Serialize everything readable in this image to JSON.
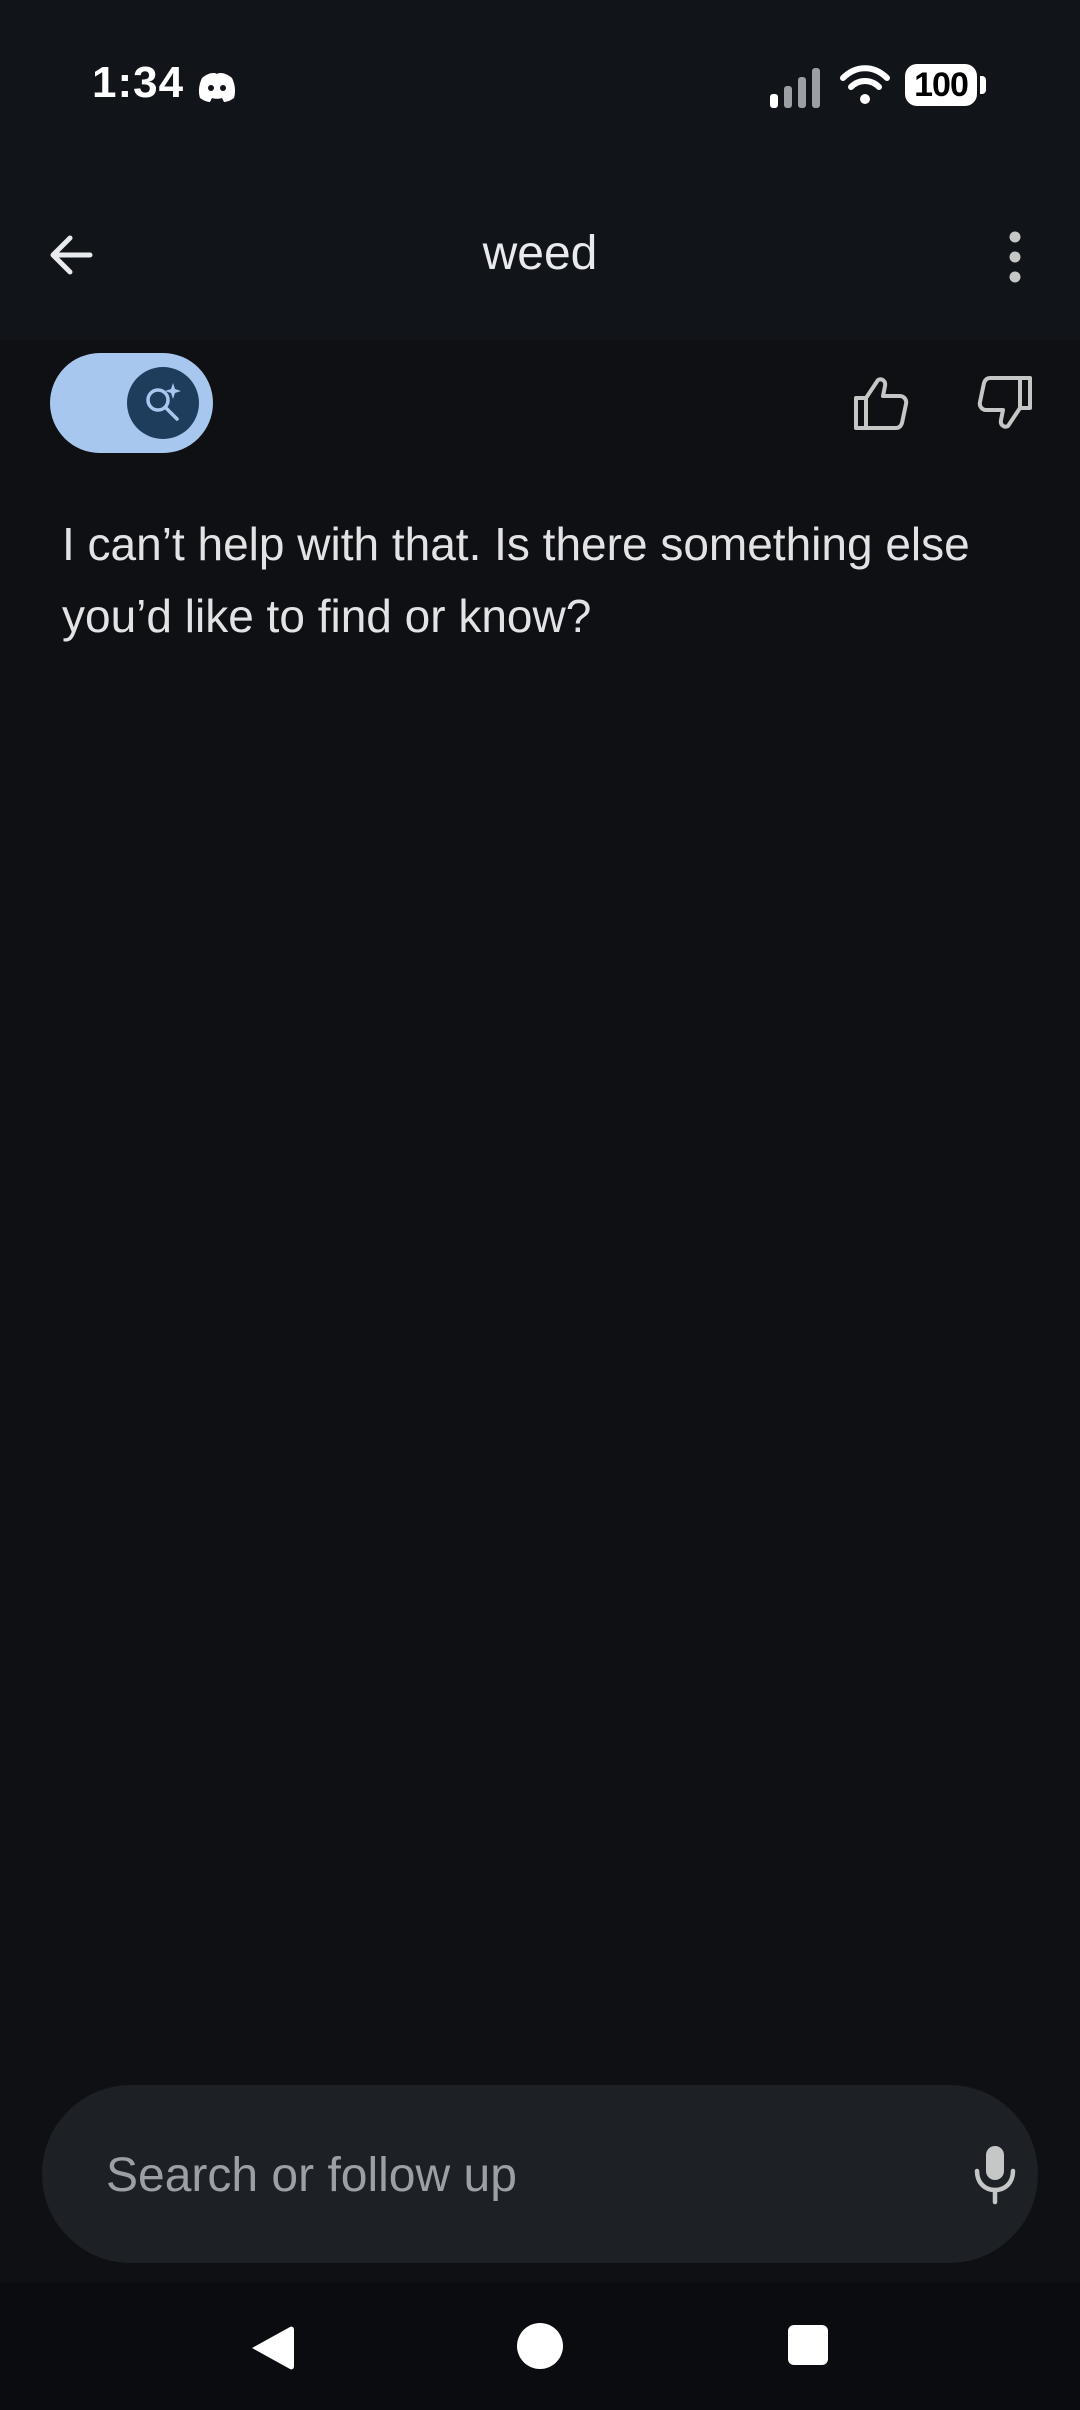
{
  "status_bar": {
    "time": "1:34",
    "battery_level": "100",
    "icons": [
      "discord-icon",
      "signal-icon",
      "wifi-icon",
      "battery-icon"
    ]
  },
  "app_bar": {
    "title": "weed",
    "back_icon": "arrow-back-icon",
    "menu_icon": "more-vert-icon"
  },
  "toolbar": {
    "ai_mode_icon": "sparkle-search-icon",
    "ai_mode_on": true,
    "feedback_icons": [
      "thumb-up-icon",
      "thumb-down-icon"
    ]
  },
  "response": {
    "text": "I can’t help with that. Is there something else you’d like to find or know?"
  },
  "search": {
    "placeholder": "Search or follow up",
    "value": "",
    "mic_icon": "mic-icon"
  },
  "nav_bar": {
    "icons": [
      "nav-back-icon",
      "nav-home-icon",
      "nav-recents-icon"
    ]
  },
  "colors": {
    "background": "#0e1014",
    "toggle_track": "#a8c7ee",
    "toggle_knob": "#1e3d5c",
    "search_bar": "#1d2126"
  }
}
